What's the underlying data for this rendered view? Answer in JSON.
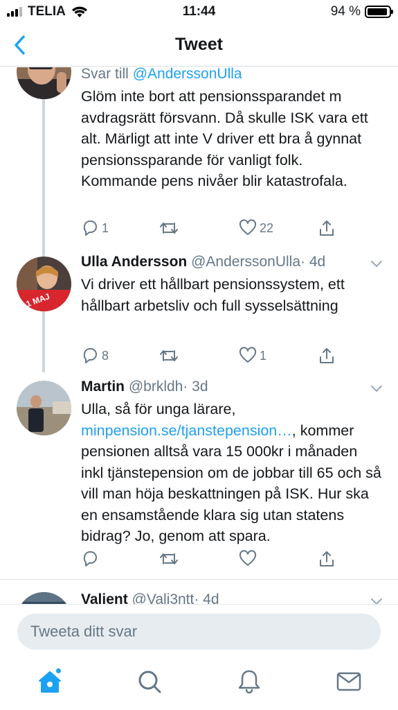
{
  "status_bar": {
    "carrier": "TELIA",
    "time": "11:44",
    "battery": "94 %"
  },
  "nav": {
    "title": "Tweet",
    "back_icon": "chevron-left-icon"
  },
  "colors": {
    "accent": "#1da1f2",
    "secondary_text": "#657786",
    "divider": "#e1e8ed"
  },
  "tweets": [
    {
      "reply_prefix": "Svar till ",
      "reply_to": "@AnderssonUlla",
      "text": "Glöm inte bort att pensionssparandet m avdragsrätt försvann. Då skulle ISK vara ett alt. Märligt att inte V driver ett bra å gynnat pensionssparande för vanligt folk. Kommande pens nivåer blir katastrofala.",
      "replies": "1",
      "retweets": "",
      "likes": "22"
    },
    {
      "name": "Ulla Andersson",
      "handle": "@AnderssonUlla",
      "time": "· 4d",
      "avatar_badge": "1 MAJ",
      "text": "Vi driver ett hållbart pensionssystem, ett hållbart arbetsliv och full sysselsättning",
      "replies": "8",
      "retweets": "",
      "likes": "1"
    },
    {
      "name": "Martin",
      "handle": "@brkldh",
      "time": "· 3d",
      "text_before": "Ulla, så för unga lärare, ",
      "link": "minpension.se/tjanstepension…",
      "text_after": ", kommer pensionen alltså vara 15 000kr i månaden inkl tjänstepension om de jobbar till 65 och så vill man höja beskattningen på ISK. Hur ska en ensamstående klara sig utan statens bidrag? Jo, genom att spara.",
      "replies": "",
      "retweets": "",
      "likes": ""
    },
    {
      "name": "Valient",
      "handle": "@Vali3ntt",
      "time": "· 4d"
    }
  ],
  "reply_box": {
    "placeholder": "Tweeta ditt svar"
  },
  "tabs": [
    "home-icon",
    "search-icon",
    "notifications-bell-icon",
    "messages-envelope-icon"
  ]
}
